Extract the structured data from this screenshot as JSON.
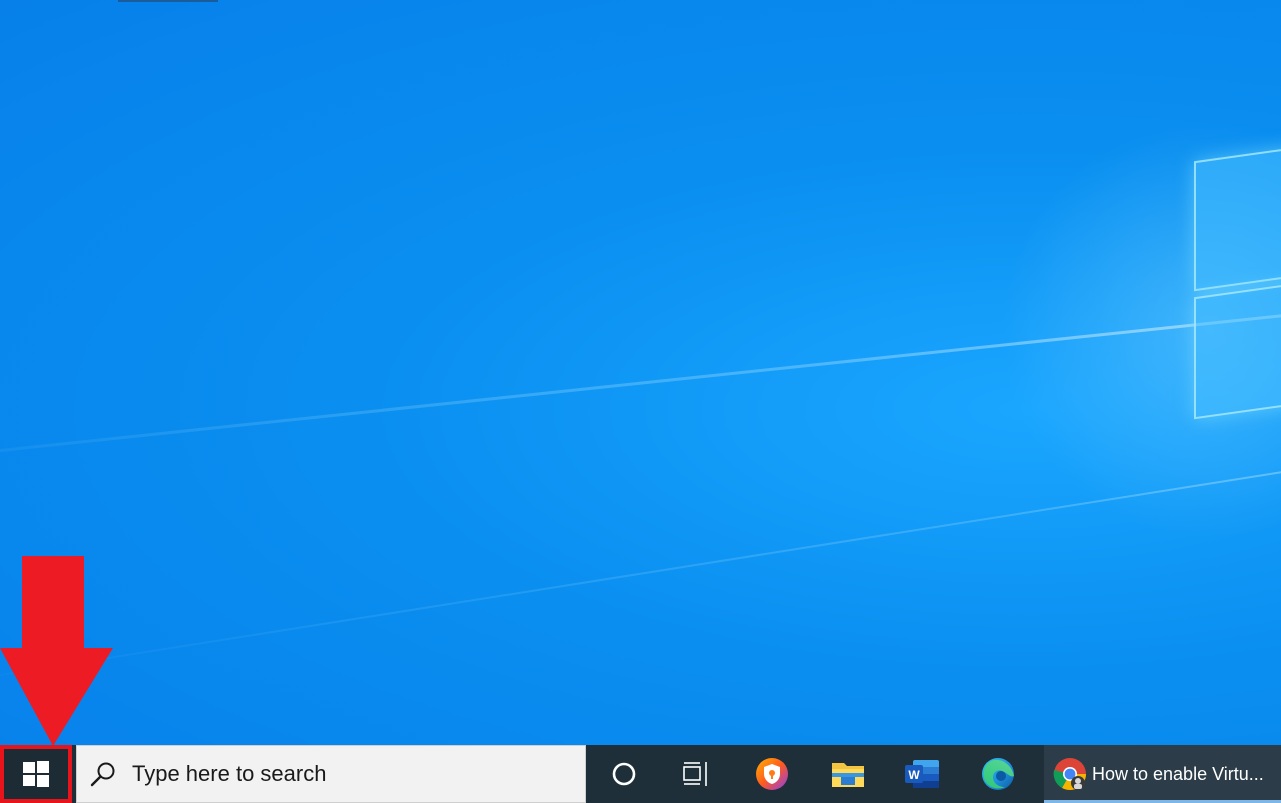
{
  "taskbar": {
    "search": {
      "placeholder": "Type here to search"
    },
    "icons": [
      {
        "name": "cortana-icon"
      },
      {
        "name": "task-view-icon"
      },
      {
        "name": "avast-secure-browser-icon"
      },
      {
        "name": "file-explorer-icon"
      },
      {
        "name": "word-icon"
      },
      {
        "name": "edge-icon"
      }
    ],
    "active_window": {
      "label": "How to enable Virtu...",
      "icon": "chrome-icon"
    }
  },
  "annotation": {
    "arrow_color": "#ED1C24",
    "highlight_color": "#E8141C"
  },
  "colors": {
    "desktop_blue": "#0A8FF0",
    "taskbar": "#1F2F3A",
    "search_bg": "#F2F2F2"
  }
}
